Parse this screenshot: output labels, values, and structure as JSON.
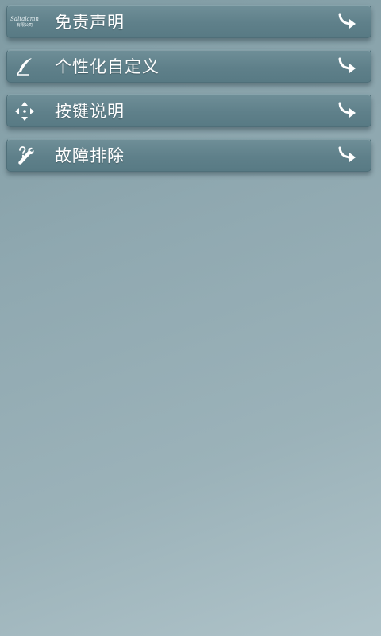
{
  "menu": {
    "items": [
      {
        "label": "免责声明",
        "icon": "logo-icon",
        "logo_script": "Saltalamn",
        "logo_cn": "有限公司"
      },
      {
        "label": "个性化自定义",
        "icon": "quill-pen-icon"
      },
      {
        "label": "按键说明",
        "icon": "four-way-arrows-icon"
      },
      {
        "label": "故障排除",
        "icon": "wrench-question-icon"
      }
    ],
    "arrow_icon": "curved-arrow-icon"
  },
  "colors": {
    "background": "#8fa8b0",
    "item_background": "#5f808a",
    "text": "#ffffff"
  }
}
